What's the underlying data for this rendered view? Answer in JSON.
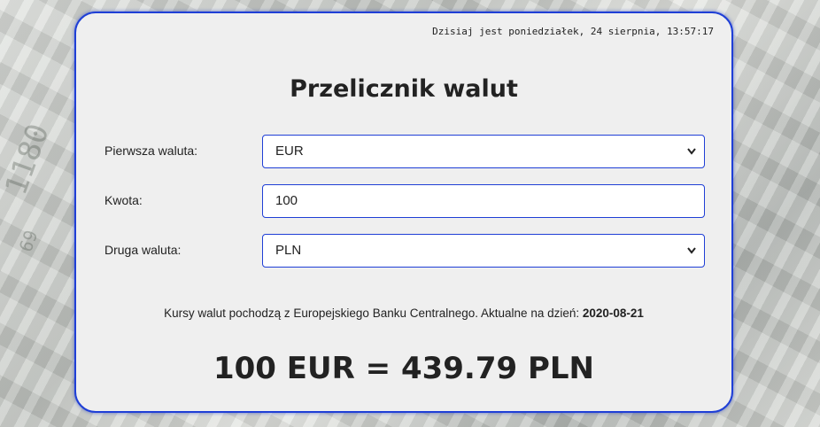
{
  "header": {
    "datetime": "Dzisiaj jest poniedziałek, 24 sierpnia, 13:57:17"
  },
  "title": "Przelicznik walut",
  "form": {
    "first_currency": {
      "label": "Pierwsza waluta:",
      "value": "EUR"
    },
    "amount": {
      "label": "Kwota:",
      "value": "100"
    },
    "second_currency": {
      "label": "Druga waluta:",
      "value": "PLN"
    }
  },
  "info": {
    "text": "Kursy walut pochodzą z Europejskiego Banku Centralnego. Aktualne na dzień:",
    "date": "2020-08-21"
  },
  "result": "100 EUR = 439.79 PLN",
  "background_decor": [
    "1180",
    "69"
  ],
  "colors": {
    "accent": "#1f3fd6",
    "card_bg": "#efefef",
    "text": "#222222"
  },
  "icons": {
    "select_arrow": "chevron-down-icon"
  }
}
